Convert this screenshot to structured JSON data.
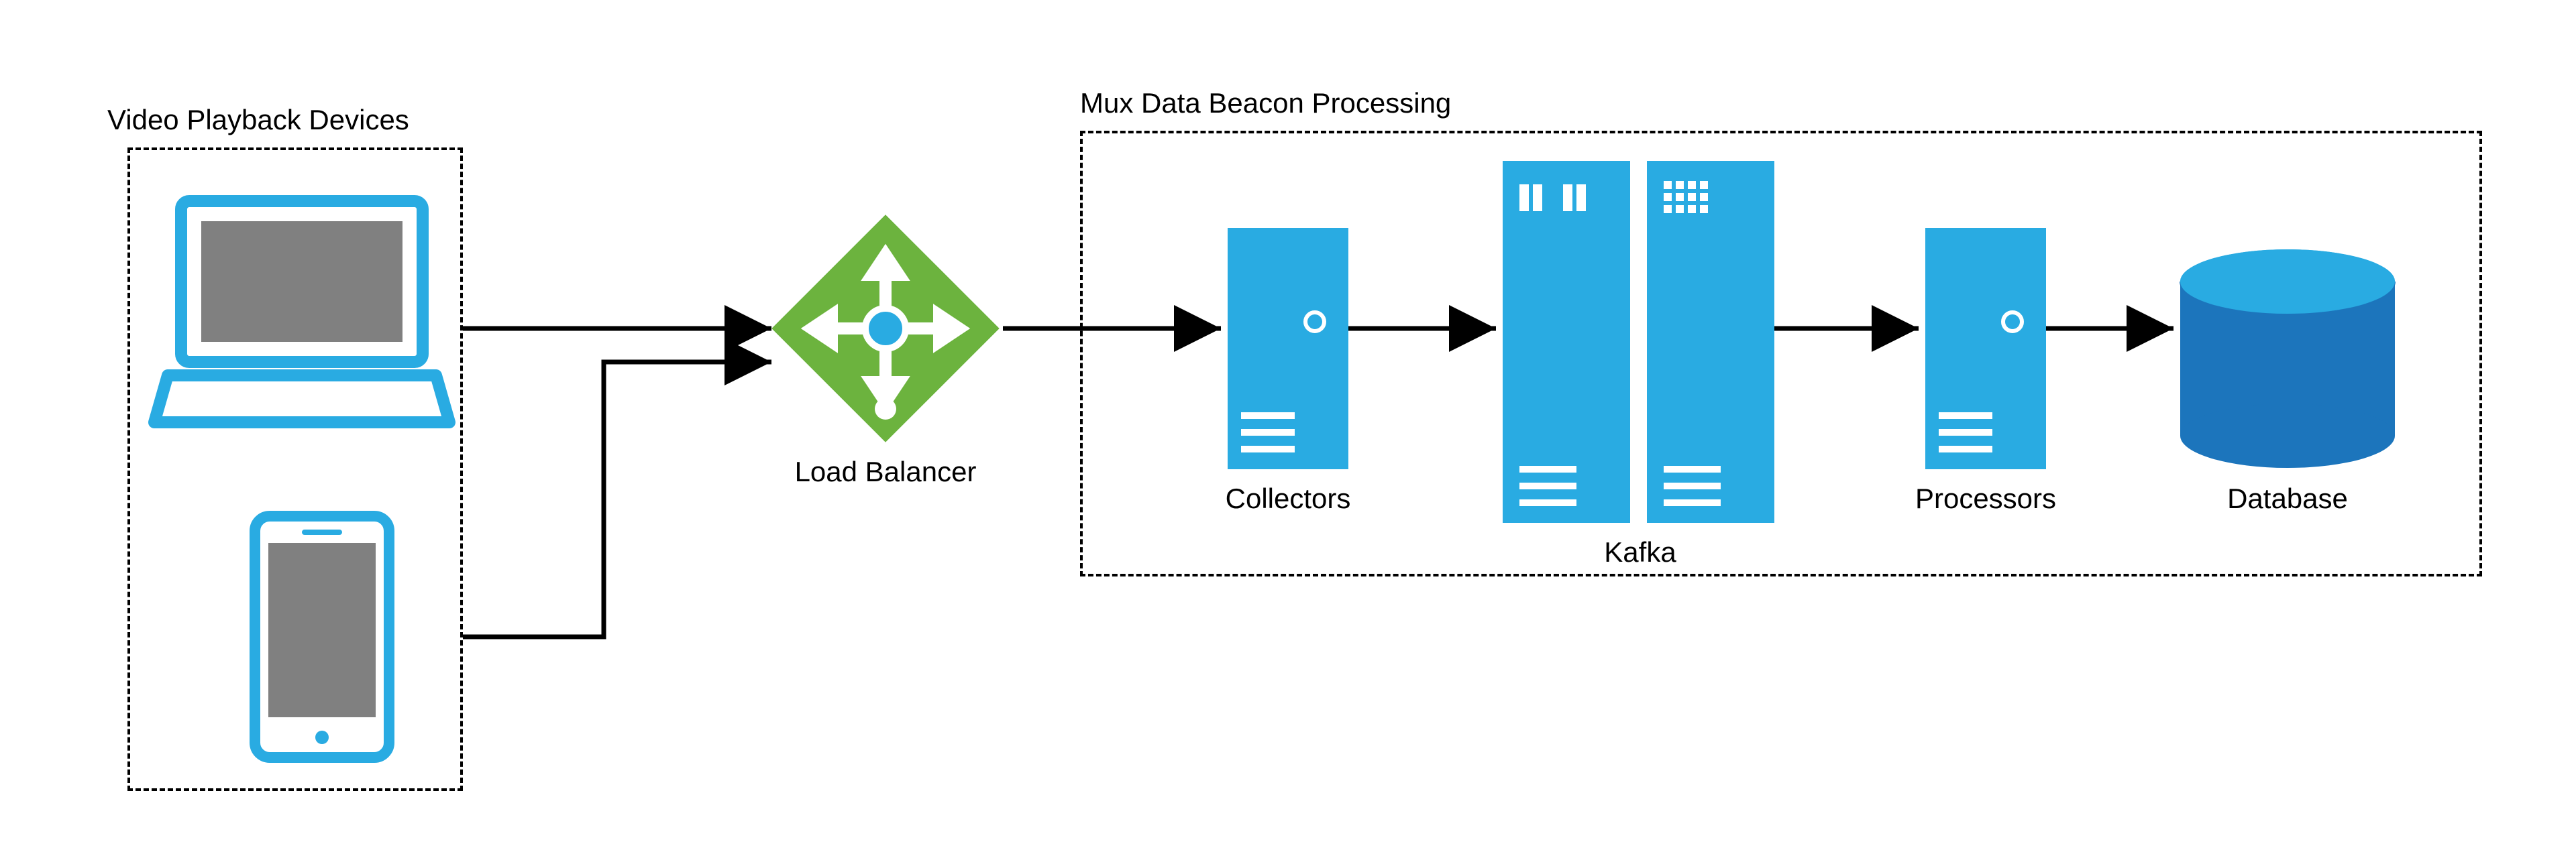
{
  "groups": {
    "devices": {
      "label": "Video Playback Devices"
    },
    "processing": {
      "label": "Mux Data Beacon Processing"
    }
  },
  "nodes": {
    "laptop": {
      "name": "laptop-icon"
    },
    "phone": {
      "name": "phone-icon"
    },
    "load_balancer": {
      "label": "Load Balancer"
    },
    "collectors": {
      "label": "Collectors"
    },
    "kafka": {
      "label": "Kafka"
    },
    "processors": {
      "label": "Processors"
    },
    "database": {
      "label": "Database"
    }
  },
  "colors": {
    "blue": "#29ABE2",
    "blue_dark": "#1C75BC",
    "green": "#6CB33E",
    "gray": "#808080"
  },
  "flow": [
    [
      "laptop",
      "load_balancer"
    ],
    [
      "phone",
      "load_balancer"
    ],
    [
      "load_balancer",
      "collectors"
    ],
    [
      "collectors",
      "kafka"
    ],
    [
      "kafka",
      "processors"
    ],
    [
      "processors",
      "database"
    ]
  ]
}
